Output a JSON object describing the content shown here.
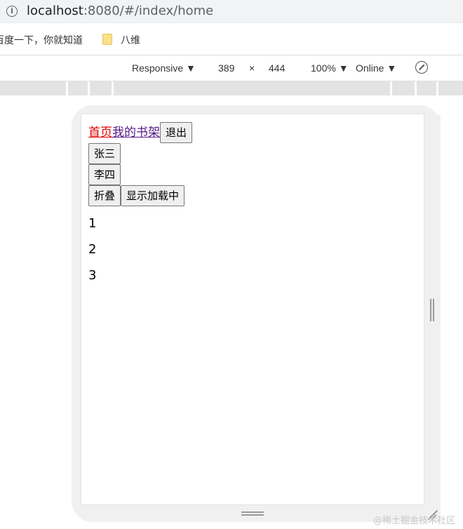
{
  "browser": {
    "url_host": "localhost",
    "url_rest": ":8080/#/index/home",
    "bookmarks": [
      "百度一下，你就知道",
      "八维"
    ]
  },
  "device_toolbar": {
    "device": "Responsive ▼",
    "width": "389",
    "times": "×",
    "height": "444",
    "zoom": "100% ▼",
    "network": "Online ▼"
  },
  "page": {
    "nav": {
      "home": "首页",
      "shelf": "我的书架",
      "logout": "退出"
    },
    "buttons": {
      "zhangsan": "张三",
      "lisi": "李四",
      "fold": "折叠",
      "loading": "显示加载中"
    },
    "list": [
      "1",
      "2",
      "3"
    ]
  },
  "watermark": "@稀土掘金技术社区"
}
